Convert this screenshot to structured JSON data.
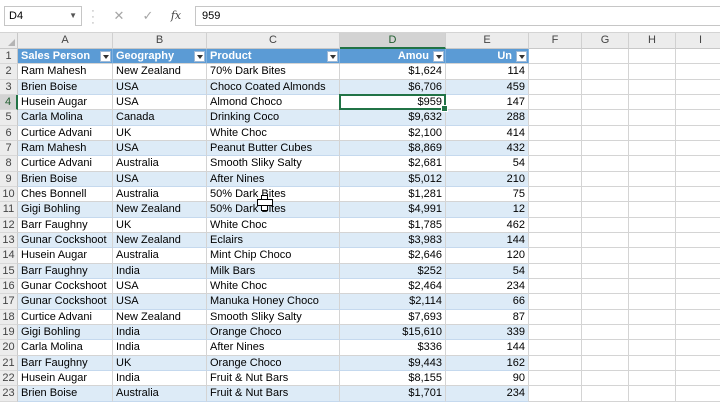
{
  "formula_bar": {
    "name_box": "D4",
    "cancel_icon": "✕",
    "enter_icon": "✓",
    "fx_label": "fx",
    "formula_value": "959"
  },
  "columns": [
    "A",
    "B",
    "C",
    "D",
    "E",
    "F",
    "G",
    "H",
    "I"
  ],
  "table_headers": [
    "Sales Person",
    "Geography",
    "Product",
    "Amou",
    "Un"
  ],
  "rows": [
    {
      "n": "1"
    },
    {
      "n": "2",
      "cells": [
        "Ram Mahesh",
        "New Zealand",
        "70% Dark Bites",
        "$1,624",
        "114"
      ]
    },
    {
      "n": "3",
      "cells": [
        "Brien Boise",
        "USA",
        "Choco Coated Almonds",
        "$6,706",
        "459"
      ]
    },
    {
      "n": "4",
      "cells": [
        "Husein Augar",
        "USA",
        "Almond Choco",
        "$959",
        "147"
      ]
    },
    {
      "n": "5",
      "cells": [
        "Carla Molina",
        "Canada",
        "Drinking Coco",
        "$9,632",
        "288"
      ]
    },
    {
      "n": "6",
      "cells": [
        "Curtice Advani",
        "UK",
        "White Choc",
        "$2,100",
        "414"
      ]
    },
    {
      "n": "7",
      "cells": [
        "Ram Mahesh",
        "USA",
        "Peanut Butter Cubes",
        "$8,869",
        "432"
      ]
    },
    {
      "n": "8",
      "cells": [
        "Curtice Advani",
        "Australia",
        "Smooth Sliky Salty",
        "$2,681",
        "54"
      ]
    },
    {
      "n": "9",
      "cells": [
        "Brien Boise",
        "USA",
        "After Nines",
        "$5,012",
        "210"
      ]
    },
    {
      "n": "10",
      "cells": [
        "Ches Bonnell",
        "Australia",
        "50% Dark Bites",
        "$1,281",
        "75"
      ]
    },
    {
      "n": "11",
      "cells": [
        "Gigi Bohling",
        "New Zealand",
        "50% Dark Bites",
        "$4,991",
        "12"
      ]
    },
    {
      "n": "12",
      "cells": [
        "Barr Faughny",
        "UK",
        "White Choc",
        "$1,785",
        "462"
      ]
    },
    {
      "n": "13",
      "cells": [
        "Gunar Cockshoot",
        "New Zealand",
        "Eclairs",
        "$3,983",
        "144"
      ]
    },
    {
      "n": "14",
      "cells": [
        "Husein Augar",
        "Australia",
        "Mint Chip Choco",
        "$2,646",
        "120"
      ]
    },
    {
      "n": "15",
      "cells": [
        "Barr Faughny",
        "India",
        "Milk Bars",
        "$252",
        "54"
      ]
    },
    {
      "n": "16",
      "cells": [
        "Gunar Cockshoot",
        "USA",
        "White Choc",
        "$2,464",
        "234"
      ]
    },
    {
      "n": "17",
      "cells": [
        "Gunar Cockshoot",
        "USA",
        "Manuka Honey Choco",
        "$2,114",
        "66"
      ]
    },
    {
      "n": "18",
      "cells": [
        "Curtice Advani",
        "New Zealand",
        "Smooth Sliky Salty",
        "$7,693",
        "87"
      ]
    },
    {
      "n": "19",
      "cells": [
        "Gigi Bohling",
        "India",
        "Orange Choco",
        "$15,610",
        "339"
      ]
    },
    {
      "n": "20",
      "cells": [
        "Carla Molina",
        "India",
        "After Nines",
        "$336",
        "144"
      ]
    },
    {
      "n": "21",
      "cells": [
        "Barr Faughny",
        "UK",
        "Orange Choco",
        "$9,443",
        "162"
      ]
    },
    {
      "n": "22",
      "cells": [
        "Husein Augar",
        "India",
        "Fruit & Nut Bars",
        "$8,155",
        "90"
      ]
    },
    {
      "n": "23",
      "cells": [
        "Brien Boise",
        "Australia",
        "Fruit & Nut Bars",
        "$1,701",
        "234"
      ]
    }
  ],
  "selection": {
    "cell": "D4",
    "column": "D",
    "row": "4"
  },
  "colors": {
    "header_fill": "#5b9bd5",
    "band_fill": "#ddebf7",
    "accent": "#217346"
  },
  "icons": {
    "filter": "filter-dropdown-icon",
    "cursor": "cell-select-cursor-icon"
  }
}
